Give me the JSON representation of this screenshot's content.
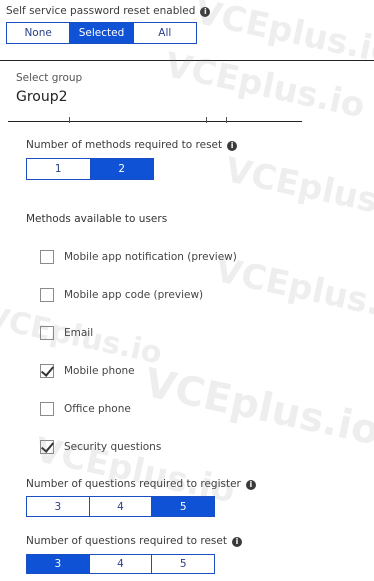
{
  "sspr": {
    "label": "Self service password reset enabled",
    "info_icon": "i",
    "options": [
      "None",
      "Selected",
      "All"
    ],
    "selected": "Selected"
  },
  "select_group": {
    "label": "Select group",
    "value": "Group2"
  },
  "methods_required": {
    "label": "Number of methods required to reset",
    "info_icon": "i",
    "options": [
      "1",
      "2"
    ],
    "selected": "2"
  },
  "methods_available": {
    "label": "Methods available to users",
    "items": [
      {
        "label": "Mobile app notification (preview)",
        "checked": false
      },
      {
        "label": "Mobile app code (preview)",
        "checked": false
      },
      {
        "label": "Email",
        "checked": false
      },
      {
        "label": "Mobile phone",
        "checked": true
      },
      {
        "label": "Office phone",
        "checked": false
      },
      {
        "label": "Security questions",
        "checked": true
      }
    ]
  },
  "questions_register": {
    "label": "Number of questions required to register",
    "info_icon": "i",
    "options": [
      "3",
      "4",
      "5"
    ],
    "selected": "5"
  },
  "questions_reset": {
    "label": "Number of questions required to reset",
    "info_icon": "i",
    "options": [
      "3",
      "4",
      "5"
    ],
    "selected": "3"
  },
  "watermark": "VCEplus.io"
}
